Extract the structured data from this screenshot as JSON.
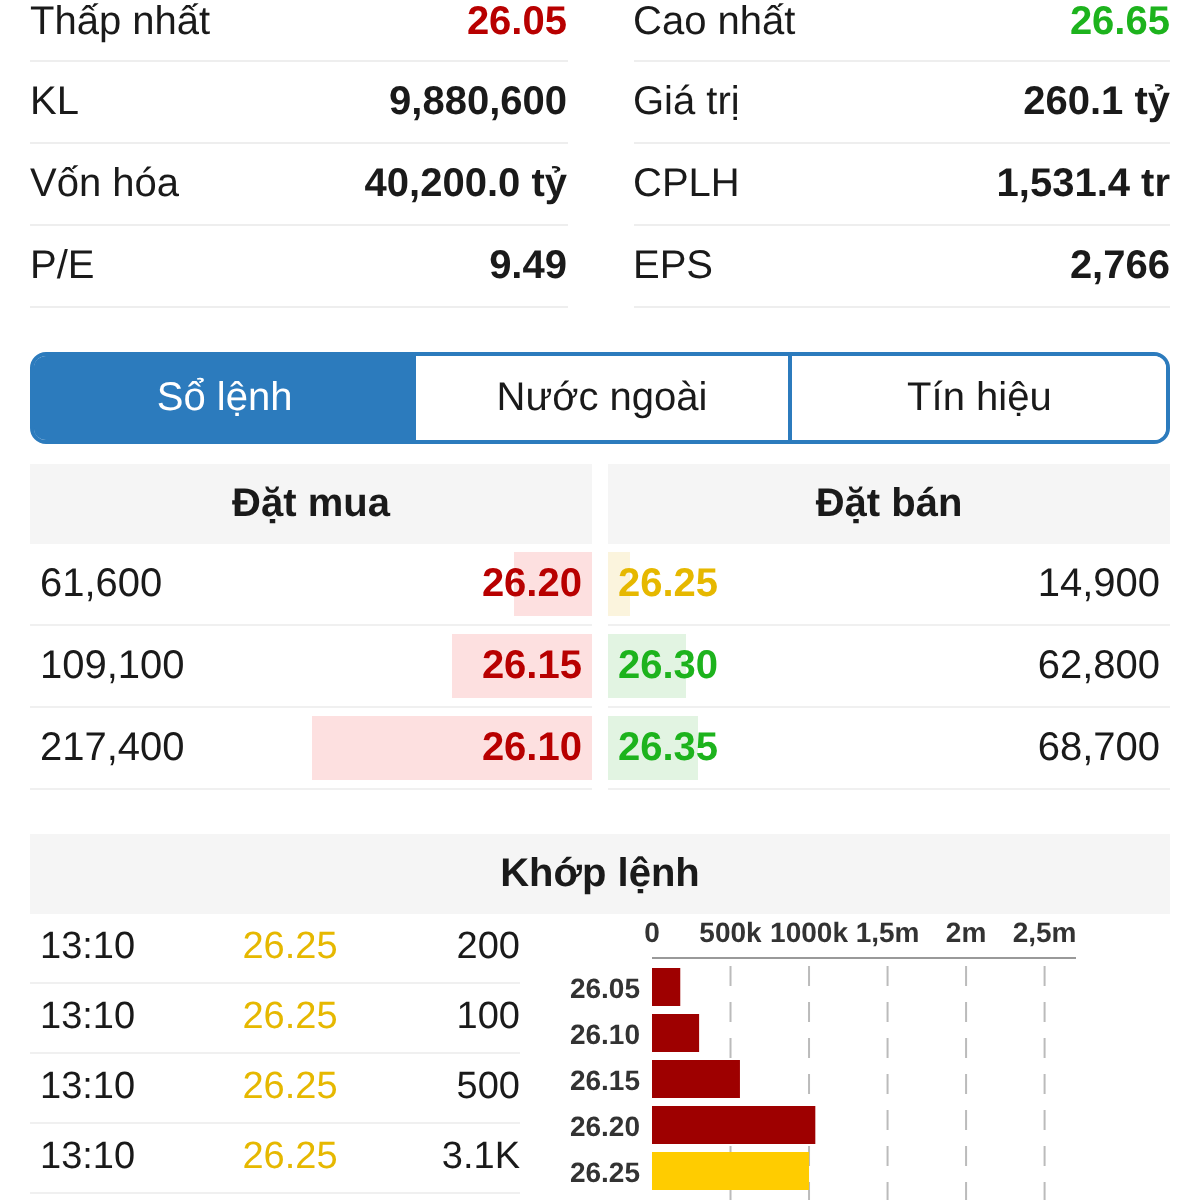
{
  "stats": [
    {
      "label": "Thấp nhất",
      "value": "26.05",
      "color": "#b80000"
    },
    {
      "label": "Cao nhất",
      "value": "26.65",
      "color": "#1db31d"
    },
    {
      "label": "KL",
      "value": "9,880,600",
      "color": "#1a1a1a"
    },
    {
      "label": "Giá trị",
      "value": "260.1 tỷ",
      "color": "#1a1a1a"
    },
    {
      "label": "Vốn hóa",
      "value": "40,200.0 tỷ",
      "color": "#1a1a1a"
    },
    {
      "label": "CPLH",
      "value": "1,531.4 tr",
      "color": "#1a1a1a"
    },
    {
      "label": "P/E",
      "value": "9.49",
      "color": "#1a1a1a"
    },
    {
      "label": "EPS",
      "value": "2,766",
      "color": "#1a1a1a"
    }
  ],
  "tabs": [
    {
      "label": "Sổ lệnh",
      "selected": true
    },
    {
      "label": "Nước ngoài",
      "selected": false
    },
    {
      "label": "Tín hiệu",
      "selected": false
    }
  ],
  "order_book": {
    "buy_title": "Đặt mua",
    "sell_title": "Đặt bán",
    "buy": [
      {
        "volume": "61,600",
        "price": "26.20",
        "color": "#b80000",
        "level": 0.14
      },
      {
        "volume": "109,100",
        "price": "26.15",
        "color": "#b80000",
        "level": 0.25
      },
      {
        "volume": "217,400",
        "price": "26.10",
        "color": "#b80000",
        "level": 0.5
      }
    ],
    "sell": [
      {
        "price": "26.25",
        "volume": "14,900",
        "color": "#e6b800",
        "level": 0.04
      },
      {
        "price": "26.30",
        "volume": "62,800",
        "color": "#1db31d",
        "level": 0.14
      },
      {
        "price": "26.35",
        "volume": "68,700",
        "color": "#1db31d",
        "level": 0.16
      }
    ]
  },
  "matches": {
    "title": "Khớp lệnh",
    "rows": [
      {
        "time": "13:10",
        "price": "26.25",
        "volume": "200",
        "color": "#e6b800"
      },
      {
        "time": "13:10",
        "price": "26.25",
        "volume": "100",
        "color": "#e6b800"
      },
      {
        "time": "13:10",
        "price": "26.25",
        "volume": "500",
        "color": "#e6b800"
      },
      {
        "time": "13:10",
        "price": "26.25",
        "volume": "3.1K",
        "color": "#e6b800"
      }
    ],
    "chart_data": {
      "type": "bar",
      "orientation": "horizontal",
      "categories": [
        "26.05",
        "26.10",
        "26.15",
        "26.20",
        "26.25"
      ],
      "series": [
        {
          "color": "#9e0000",
          "values": [
            180000,
            300000,
            560000,
            1040000,
            null
          ]
        },
        {
          "color": "#ffcc00",
          "values": [
            null,
            null,
            null,
            null,
            1000000
          ]
        }
      ],
      "grid": true,
      "xlim": [
        0,
        2700000
      ],
      "xticks": [
        {
          "value": 0,
          "label": "0"
        },
        {
          "value": 500000,
          "label": "500k"
        },
        {
          "value": 1000000,
          "label": "1000k"
        },
        {
          "value": 1500000,
          "label": "1,5m"
        },
        {
          "value": 2000000,
          "label": "2m"
        },
        {
          "value": 2500000,
          "label": "2,5m"
        }
      ]
    }
  }
}
